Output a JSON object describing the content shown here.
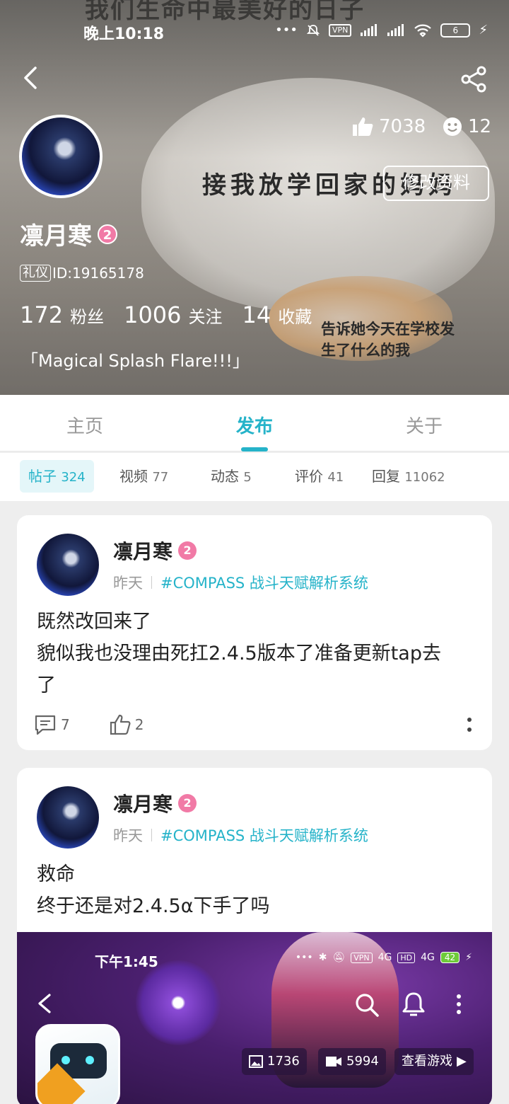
{
  "status_bar": {
    "time": "晚上10:18",
    "vpn": "VPN",
    "battery": "6"
  },
  "banner": {
    "meme_top": "我们生命中最美好的日子",
    "meme_mid": "接我放学回家的妈妈",
    "meme_bottom": "告诉她今天在学校发生了什么的我"
  },
  "profile": {
    "likes": "7038",
    "smiles": "12",
    "edit_label": "修改资料",
    "name": "凛月寒",
    "level": "2",
    "tag": "礼仪",
    "id_text": "ID:19165178",
    "stats": [
      {
        "num": "172",
        "label": "粉丝"
      },
      {
        "num": "1006",
        "label": "关注"
      },
      {
        "num": "14",
        "label": "收藏"
      }
    ],
    "bio": "「Magical Splash Flare!!!」"
  },
  "tabs": [
    "主页",
    "发布",
    "关于"
  ],
  "active_tab": "发布",
  "subtabs": [
    {
      "label": "帖子",
      "count": "324"
    },
    {
      "label": "视频",
      "count": "77"
    },
    {
      "label": "动态",
      "count": "5"
    },
    {
      "label": "评价",
      "count": "41"
    },
    {
      "label": "回复",
      "count": "11062"
    }
  ],
  "posts": [
    {
      "author": "凛月寒",
      "level": "2",
      "time": "昨天",
      "topic": "#COMPASS 战斗天赋解析系统",
      "lines": [
        "既然改回来了",
        "貌似我也没理由死扛2.4.5版本了准备更新tap去",
        "了"
      ],
      "comments": "7",
      "likes": "2"
    },
    {
      "author": "凛月寒",
      "level": "2",
      "time": "昨天",
      "topic": "#COMPASS 战斗天赋解析系统",
      "lines": [
        "救命",
        "终于还是对2.4.5α下手了吗"
      ],
      "screenshot": {
        "time": "下午1:45",
        "net1": "4G",
        "hd": "HD",
        "net2": "4G",
        "battery": "42",
        "vpn": "VPN",
        "images": "1736",
        "videos": "5994",
        "view_game": "查看游戏"
      }
    }
  ],
  "colors": {
    "accent": "#25b3c9",
    "level_badge": "#f17aa6"
  }
}
